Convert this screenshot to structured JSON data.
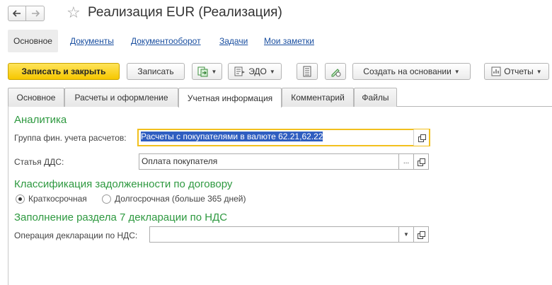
{
  "window": {
    "title": "Реализация EUR (Реализация)"
  },
  "section_nav": {
    "active": "Основное",
    "links": [
      "Документы",
      "Документооборот",
      "Задачи",
      "Мои заметки"
    ]
  },
  "toolbar": {
    "save_close": "Записать и закрыть",
    "save": "Записать",
    "edo": "ЭДО",
    "create_based": "Создать на основании",
    "reports": "Отчеты"
  },
  "tabs": [
    "Основное",
    "Расчеты и оформление",
    "Учетная информация",
    "Комментарий",
    "Файлы"
  ],
  "form": {
    "analytics_title": "Аналитика",
    "group_label": "Группа фин. учета расчетов:",
    "group_value": "Расчеты с покупателями в валюте 62.21,62.22",
    "dds_label": "Статья ДДС:",
    "dds_value": "Оплата покупателя",
    "debt_title": "Классификация задолженности по договору",
    "radio_short": "Краткосрочная",
    "radio_long": "Долгосрочная (больше 365 дней)",
    "debt_selected": "Краткосрочная",
    "vat_title": "Заполнение раздела 7 декларации по НДС",
    "vat_label": "Операция декларации по НДС:",
    "vat_value": ""
  },
  "icons": {
    "back": "arrow-left-icon",
    "forward": "arrow-right-icon",
    "favorite": "star-icon"
  },
  "colors": {
    "accent_green": "#2e9940",
    "primary_button": "#f6c700",
    "link": "#1a4fa0",
    "selection": "#2f5ec0",
    "focus_border": "#f2c01e"
  }
}
